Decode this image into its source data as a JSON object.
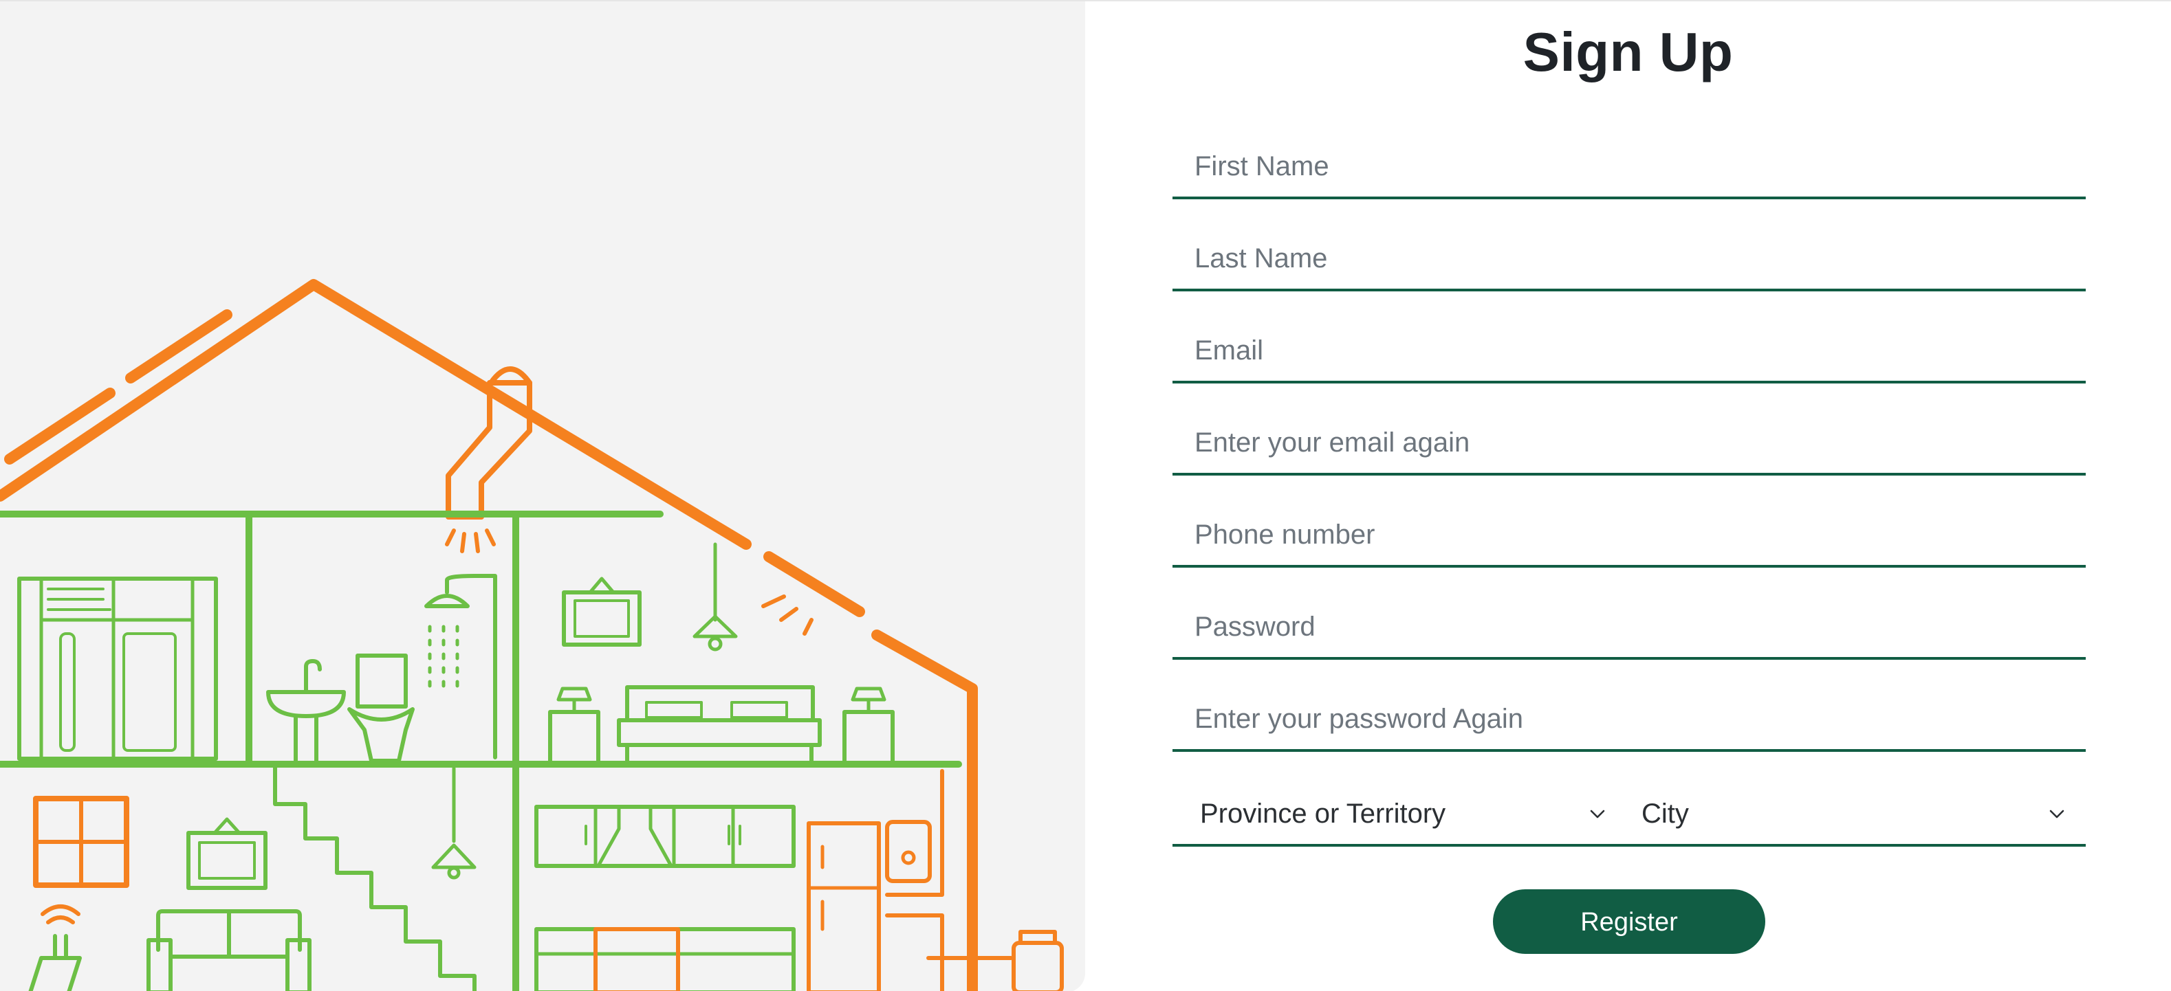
{
  "form": {
    "title": "Sign Up",
    "fields": [
      {
        "placeholder": "First Name",
        "value": ""
      },
      {
        "placeholder": "Last Name",
        "value": ""
      },
      {
        "placeholder": "Email",
        "value": ""
      },
      {
        "placeholder": "Enter your email again",
        "value": ""
      },
      {
        "placeholder": "Phone number",
        "value": ""
      },
      {
        "placeholder": "Password",
        "value": ""
      },
      {
        "placeholder": "Enter your password Again",
        "value": ""
      }
    ],
    "province_select": {
      "selected": "Province or Territory",
      "icon": "chevron-down-icon"
    },
    "city_select": {
      "selected": "City",
      "icon": "chevron-down-icon"
    },
    "register_label": "Register"
  },
  "illustration": {
    "icon": "house-cutaway-illustration",
    "colors": {
      "orange": "#f5811f",
      "green": "#6cbf45",
      "background": "#f3f3f3"
    }
  },
  "colors": {
    "accent": "#115d44",
    "title_text": "#1f2328",
    "placeholder": "#6d757d"
  }
}
